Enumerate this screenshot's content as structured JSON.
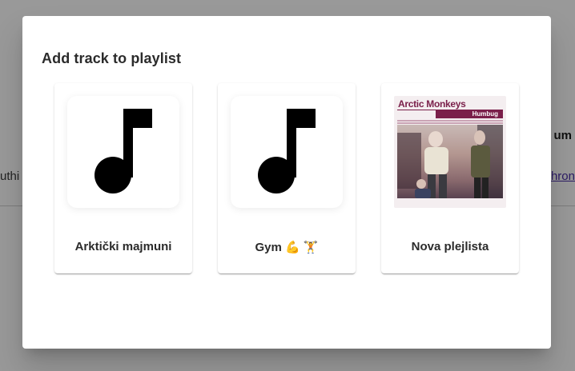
{
  "background": {
    "left_fragment": "uthi",
    "right_fragment_top": "um",
    "right_fragment_link": "hron"
  },
  "dialog": {
    "title": "Add track to playlist",
    "playlists": [
      {
        "name": "Arktički majmuni",
        "cover": "music-note-icon"
      },
      {
        "name": "Gym 💪 🏋️",
        "cover": "music-note-icon"
      },
      {
        "name": "Nova plejlista",
        "cover": "album-cover",
        "cover_text": {
          "band": "Arctic Monkeys",
          "album": "Humbug"
        }
      }
    ]
  },
  "colors": {
    "overlay": "#00000066",
    "accent_link": "#4a2ea8",
    "cover_accent": "#7a1f4a"
  }
}
